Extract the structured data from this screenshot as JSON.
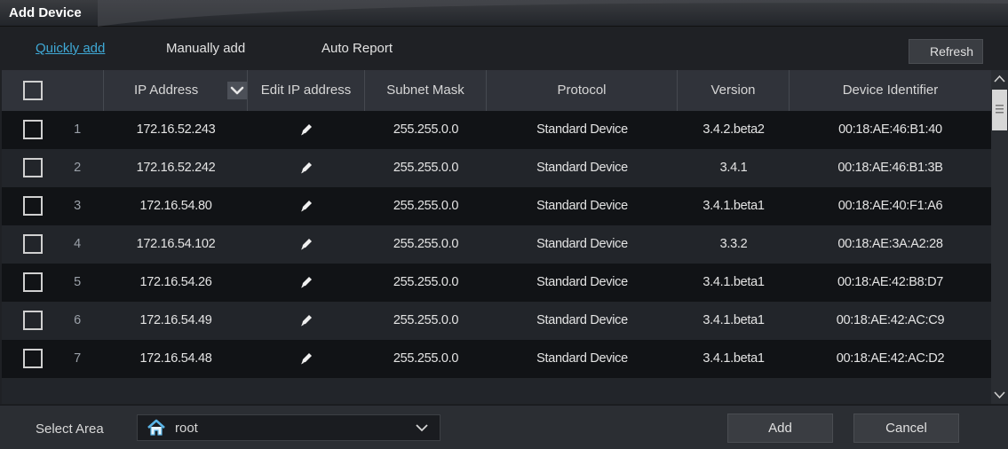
{
  "window": {
    "title": "Add Device"
  },
  "tabs": [
    {
      "label": "Quickly add",
      "active": true
    },
    {
      "label": "Manually add",
      "active": false
    },
    {
      "label": "Auto Report",
      "active": false
    }
  ],
  "toolbar": {
    "refresh_label": "Refresh"
  },
  "table": {
    "headers": {
      "ip": "IP Address",
      "edit": "Edit IP address",
      "mask": "Subnet Mask",
      "protocol": "Protocol",
      "version": "Version",
      "identifier": "Device Identifier"
    },
    "rows": [
      {
        "n": "1",
        "ip": "172.16.52.243",
        "mask": "255.255.0.0",
        "protocol": "Standard Device",
        "version": "3.4.2.beta2",
        "id": "00:18:AE:46:B1:40"
      },
      {
        "n": "2",
        "ip": "172.16.52.242",
        "mask": "255.255.0.0",
        "protocol": "Standard Device",
        "version": "3.4.1",
        "id": "00:18:AE:46:B1:3B"
      },
      {
        "n": "3",
        "ip": "172.16.54.80",
        "mask": "255.255.0.0",
        "protocol": "Standard Device",
        "version": "3.4.1.beta1",
        "id": "00:18:AE:40:F1:A6"
      },
      {
        "n": "4",
        "ip": "172.16.54.102",
        "mask": "255.255.0.0",
        "protocol": "Standard Device",
        "version": "3.3.2",
        "id": "00:18:AE:3A:A2:28"
      },
      {
        "n": "5",
        "ip": "172.16.54.26",
        "mask": "255.255.0.0",
        "protocol": "Standard Device",
        "version": "3.4.1.beta1",
        "id": "00:18:AE:42:B8:D7"
      },
      {
        "n": "6",
        "ip": "172.16.54.49",
        "mask": "255.255.0.0",
        "protocol": "Standard Device",
        "version": "3.4.1.beta1",
        "id": "00:18:AE:42:AC:C9"
      },
      {
        "n": "7",
        "ip": "172.16.54.48",
        "mask": "255.255.0.0",
        "protocol": "Standard Device",
        "version": "3.4.1.beta1",
        "id": "00:18:AE:42:AC:D2"
      }
    ]
  },
  "footer": {
    "select_area_label": "Select Area",
    "area_value": "root",
    "add_label": "Add",
    "cancel_label": "Cancel"
  },
  "icons": {
    "edit": "pencil-icon",
    "sort": "chevron-down-icon",
    "home": "home-icon"
  },
  "colors": {
    "accent": "#3fa9d6"
  }
}
